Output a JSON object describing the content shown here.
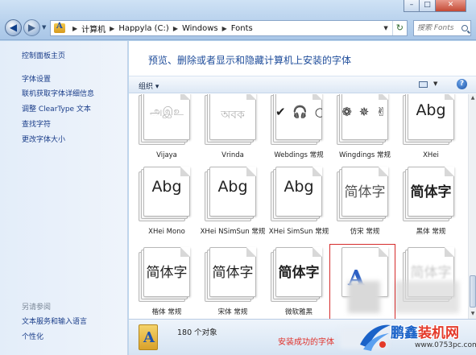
{
  "window": {
    "controls": {
      "minimize": "–",
      "maximize": "□",
      "close": "✕"
    }
  },
  "nav": {
    "back": "◀",
    "forward": "▶",
    "dropdown": "▼"
  },
  "address": {
    "crumbs": [
      "计算机",
      "Happyla (C:)",
      "Windows",
      "Fonts"
    ],
    "dropdown": "▼",
    "refresh": "↻"
  },
  "search": {
    "placeholder": "搜索 Fonts"
  },
  "sidebar": {
    "links": [
      "控制面板主页",
      "字体设置",
      "联机获取字体详细信息",
      "调整 ClearType 文本",
      "查找字符",
      "更改字体大小"
    ],
    "see_also_heading": "另请参阅",
    "see_also": [
      "文本服务和输入语言",
      "个性化"
    ]
  },
  "main": {
    "title": "预览、删除或者显示和隐藏计算机上安装的字体",
    "organize_label": "组织 ▾",
    "view_dropdown": "▼",
    "help": "?"
  },
  "fonts": [
    {
      "name": "Vijaya",
      "sample": "அஇஉ"
    },
    {
      "name": "Vrinda",
      "sample": "অবক"
    },
    {
      "name": "Webdings 常规",
      "sample": "✔ 🎧 ○"
    },
    {
      "name": "Wingdings 常规",
      "sample": "❁ ✵ ✌"
    },
    {
      "name": "XHei",
      "sample": "Abg"
    },
    {
      "name": "XHei Mono",
      "sample": "Abg"
    },
    {
      "name": "XHei NSimSun 常规",
      "sample": "Abg"
    },
    {
      "name": "XHei SimSun 常规",
      "sample": "Abg"
    },
    {
      "name": "仿宋 常规",
      "sample": "简体字"
    },
    {
      "name": "黑体 常规",
      "sample": "简体字"
    },
    {
      "name": "楷体 常规",
      "sample": "简体字"
    },
    {
      "name": "宋体 常规",
      "sample": "简体字"
    },
    {
      "name": "微软雅黑",
      "sample": "简体字"
    },
    {
      "name": "",
      "sample": "A"
    },
    {
      "name": "",
      "sample": "简体字"
    }
  ],
  "details": {
    "count": "180 个对象",
    "caption": "安装成功的字体"
  },
  "watermark": {
    "title_a": "鹏鑫",
    "title_b": "装机网",
    "url": "www.0753pc.com"
  },
  "colors": {
    "caption_red": "#e0312a",
    "link_blue": "#1b3e8a",
    "title_blue": "#1e4c9a"
  }
}
